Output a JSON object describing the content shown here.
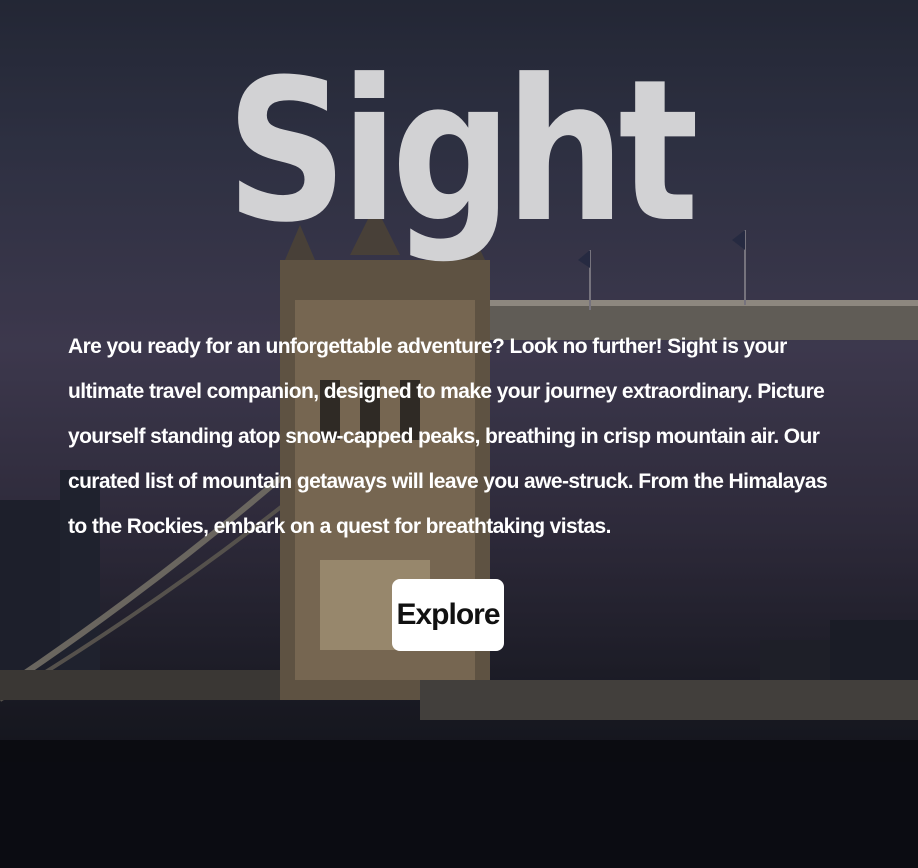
{
  "hero": {
    "title": "Sight",
    "description": "Are you ready for an unforgettable adventure? Look no further! Sight is your ultimate travel companion, designed to make your journey extraordinary. Picture yourself standing atop snow-capped peaks, breathing in crisp mountain air. Our curated list of mountain getaways will leave you awe-struck. From the Himalayas to the Rockies, embark on a quest for breathtaking vistas.",
    "explore_label": "Explore",
    "background_image": "tower-bridge-london-night"
  },
  "colors": {
    "title": "#d2d2d4",
    "text": "#ffffff",
    "button_bg": "#ffffff",
    "button_text": "#111111"
  }
}
